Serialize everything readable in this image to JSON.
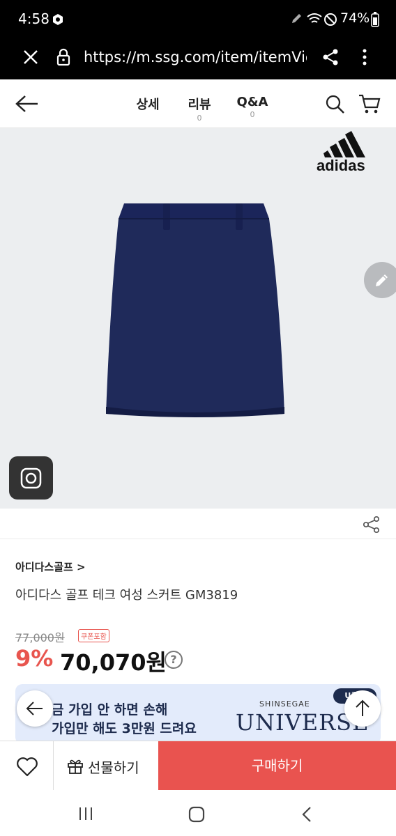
{
  "status_bar": {
    "time": "4:58",
    "battery": "74%",
    "icons": [
      "notification-app-icon",
      "pen-icon",
      "wifi-icon",
      "do-not-disturb-icon",
      "battery-icon"
    ]
  },
  "browser": {
    "url": "https://m.ssg.com/item/itemView",
    "icons": [
      "close-icon",
      "lock-icon",
      "share-icon",
      "more-vert-icon"
    ]
  },
  "header": {
    "tabs": [
      {
        "label": "상세",
        "count": ""
      },
      {
        "label": "리뷰",
        "count": "0"
      },
      {
        "label": "Q&A",
        "count": "0"
      }
    ]
  },
  "hero": {
    "brand_logo_text": "adidas",
    "icons": [
      "edit-pencil-icon",
      "camera-lens-icon",
      "share-nodes-icon"
    ]
  },
  "product": {
    "brand": "아디다스골프 >",
    "name": "아디다스 골프 테크 여성 스커트 GM3819",
    "original_price": "77,000원",
    "coupon_badge": "쿠폰포함",
    "discount": "9%",
    "price": "70,070원",
    "help": "?"
  },
  "banner": {
    "line1": "금 가입 안 하면 손해",
    "line2": "가입만 해도 3만원 드려요",
    "brand_small": "SHINSEGAE",
    "brand_large": "UNIVERSE",
    "badge": "U클럽"
  },
  "bottom": {
    "gift_label": "선물하기",
    "buy_label": "구매하기"
  },
  "colors": {
    "accent": "#e9534f",
    "skirt": "#1f2a5a",
    "hero_bg": "#eceef0"
  }
}
